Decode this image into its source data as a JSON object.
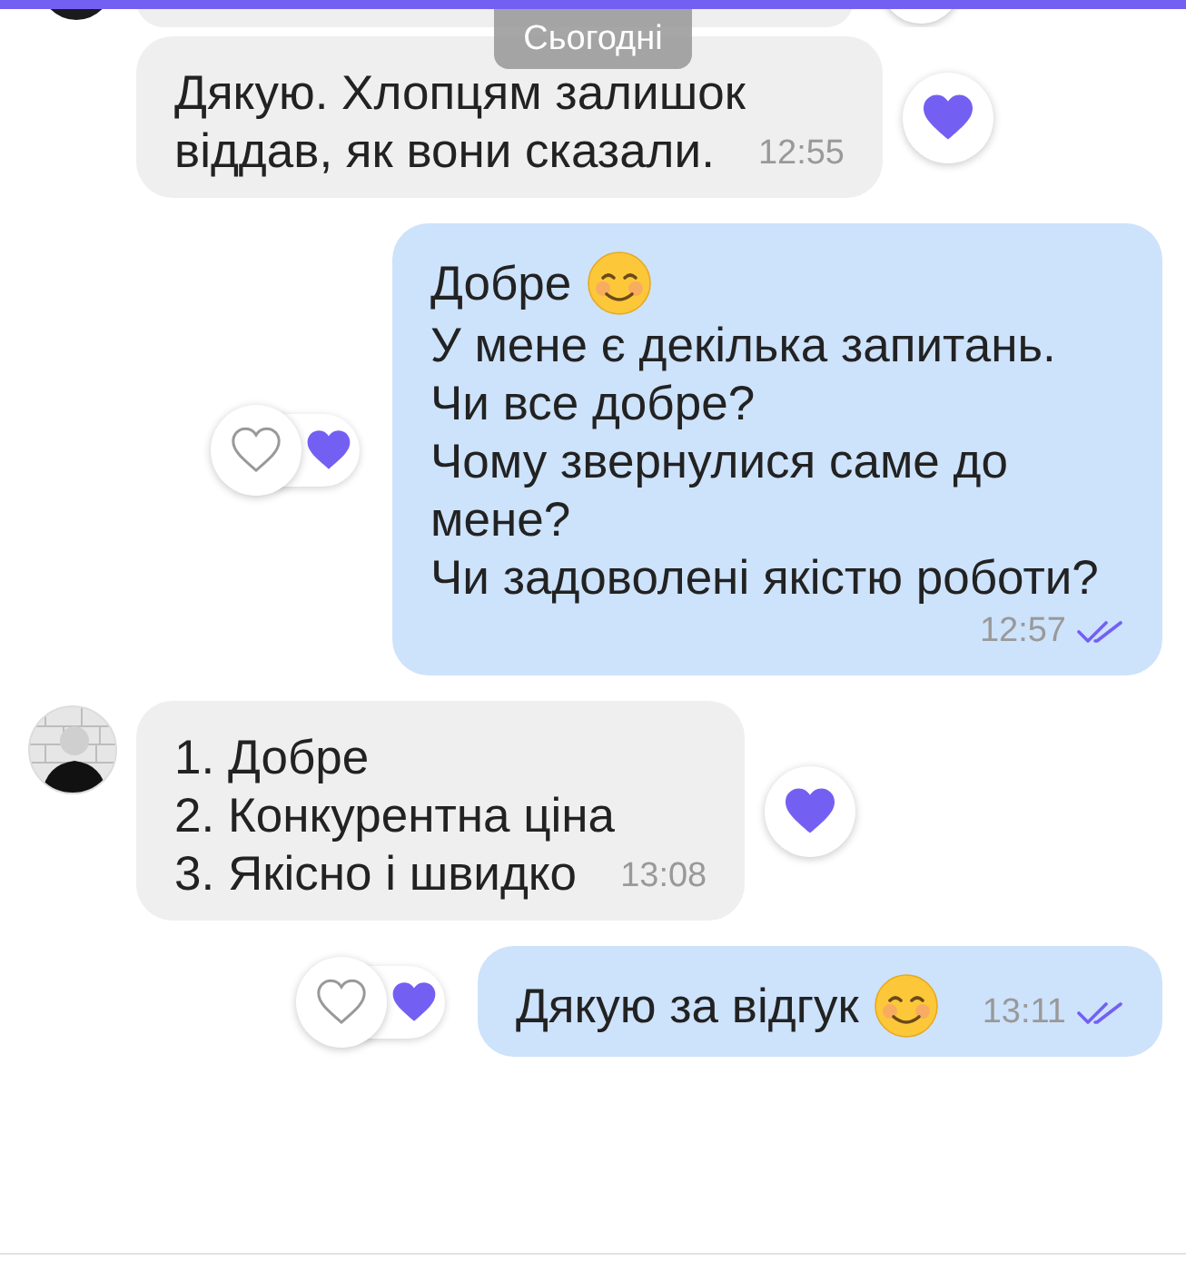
{
  "date_chip": "Сьогодні",
  "messages": [
    {
      "kind": "incoming",
      "show_avatar": false,
      "lines": [
        {
          "text": "Дякую. Хлопцям залишок",
          "emoji": false
        },
        {
          "text": "віддав, як вони сказали.",
          "emoji": false
        }
      ],
      "time": "12:55",
      "liked": true
    },
    {
      "kind": "outgoing",
      "lines": [
        {
          "text": "Добре",
          "emoji": true
        },
        {
          "text": "У мене є декілька запитань.",
          "emoji": false
        },
        {
          "text": "Чи все добре?",
          "emoji": false
        },
        {
          "text": "Чому звернулися саме до мене?",
          "emoji": false
        },
        {
          "text": "Чи задоволені якістю роботи?",
          "emoji": false
        }
      ],
      "time": "12:57",
      "read": true,
      "liked": false,
      "partner_liked": true
    },
    {
      "kind": "incoming",
      "show_avatar": true,
      "lines": [
        {
          "text": "1. Добре",
          "emoji": false
        },
        {
          "text": "2. Конкурентна ціна",
          "emoji": false
        },
        {
          "text": "3. Якісно і швидко",
          "emoji": false
        }
      ],
      "time": "13:08",
      "liked": true
    },
    {
      "kind": "outgoing",
      "lines": [
        {
          "text": "Дякую за відгук",
          "emoji": true
        }
      ],
      "time": "13:11",
      "read": true,
      "liked": false,
      "partner_liked": true
    }
  ]
}
